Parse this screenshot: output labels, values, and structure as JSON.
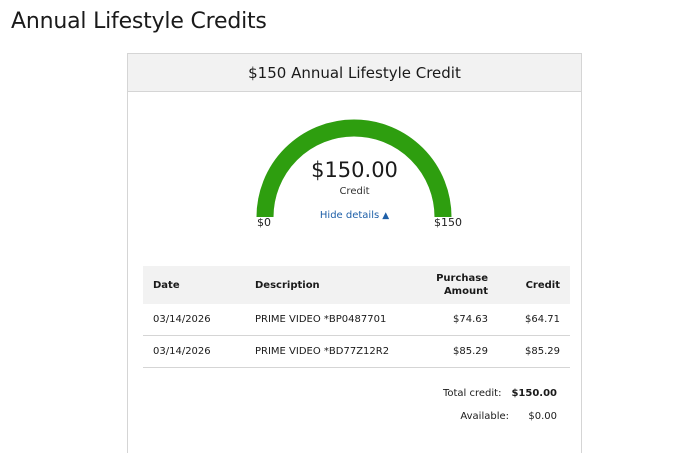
{
  "page": {
    "title": "Annual Lifestyle Credits"
  },
  "card": {
    "title": "$150 Annual Lifestyle Credit",
    "gauge": {
      "amount": "$150.00",
      "caption": "Credit",
      "toggle_label": "Hide details",
      "min_label": "$0",
      "max_label": "$150",
      "fill_fraction": 1.0,
      "fill_color": "#2e9e0f"
    },
    "table": {
      "headers": {
        "date": "Date",
        "description": "Description",
        "purchase_amount": "Purchase Amount",
        "credit": "Credit"
      },
      "rows": [
        {
          "date": "03/14/2026",
          "description": "PRIME VIDEO *BP0487701",
          "purchase_amount": "$74.63",
          "credit": "$64.71"
        },
        {
          "date": "03/14/2026",
          "description": "PRIME VIDEO *BD77Z12R2",
          "purchase_amount": "$85.29",
          "credit": "$85.29"
        }
      ]
    },
    "totals": {
      "total_label": "Total credit:",
      "total_value": "$150.00",
      "available_label": "Available:",
      "available_value": "$0.00"
    }
  }
}
